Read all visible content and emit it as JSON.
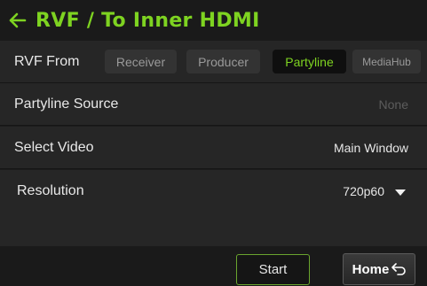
{
  "header": {
    "title": "RVF / To Inner HDMI",
    "back_icon": "back-arrow-icon"
  },
  "rvf_from": {
    "label": "RVF From",
    "options": [
      "Receiver",
      "Producer",
      "Partyline",
      "MediaHub"
    ],
    "selected": "Partyline"
  },
  "partyline_source": {
    "label": "Partyline Source",
    "value": "None"
  },
  "select_video": {
    "label": "Select Video",
    "value": "Main Window"
  },
  "resolution": {
    "label": "Resolution",
    "value": "720p60"
  },
  "footer": {
    "start_label": "Start",
    "home_label": "Home",
    "home_icon": "return-arrow-icon"
  },
  "colors": {
    "accent": "#7ed321",
    "row_bg": "#262626",
    "header_bg": "#1a1a1a"
  }
}
